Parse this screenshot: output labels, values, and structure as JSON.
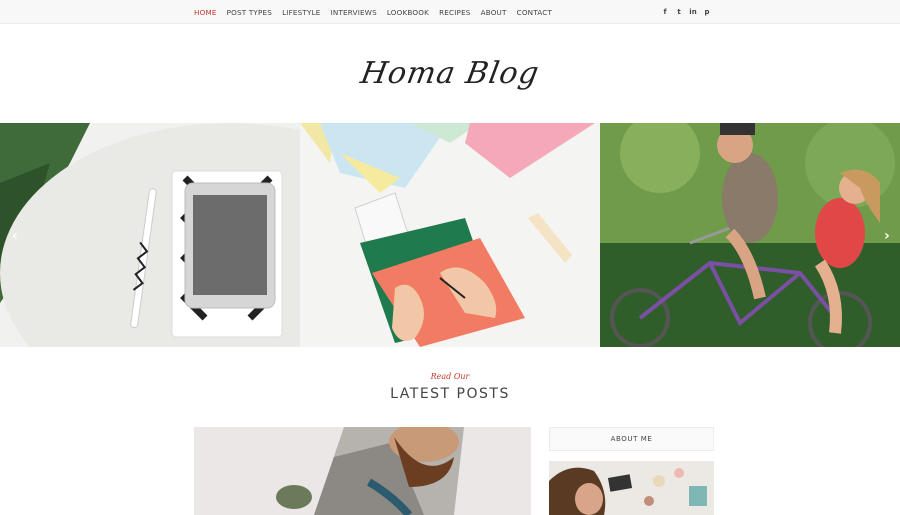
{
  "nav": {
    "items": [
      "HOME",
      "POST TYPES",
      "LIFESTYLE",
      "INTERVIEWS",
      "LOOKBOOK",
      "RECIPES",
      "ABOUT",
      "CONTACT"
    ],
    "active_index": 0
  },
  "social": {
    "facebook": "f",
    "twitter": "t",
    "linkedin": "in",
    "pinterest": "p"
  },
  "logo": "Homa Blog",
  "slider": {
    "prev": "‹",
    "next": "›"
  },
  "section": {
    "kicker": "Read Our",
    "title": "LATEST POSTS"
  },
  "sidebar": {
    "about_title": "ABOUT ME"
  },
  "colors": {
    "accent": "#c0392b",
    "text": "#444444",
    "topbar_bg": "#f8f8f8"
  }
}
